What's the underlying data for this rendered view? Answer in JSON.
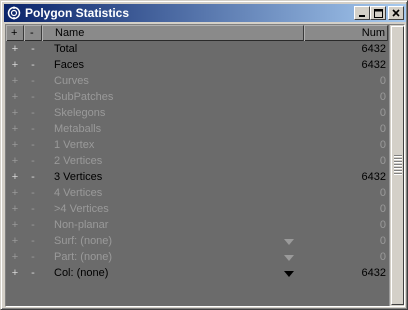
{
  "window": {
    "title": "Polygon Statistics",
    "icon": "lightwave-app-icon"
  },
  "header": {
    "plus_label": "+",
    "minus_label": "-",
    "name_label": "Name",
    "num_label": "Num"
  },
  "rows": [
    {
      "plus": "+",
      "minus": "-",
      "name": "Total",
      "value": "6432",
      "active": true,
      "dropdown": false
    },
    {
      "plus": "+",
      "minus": "-",
      "name": "Faces",
      "value": "6432",
      "active": true,
      "dropdown": false
    },
    {
      "plus": "+",
      "minus": "-",
      "name": "Curves",
      "value": "0",
      "active": false,
      "dropdown": false
    },
    {
      "plus": "+",
      "minus": "-",
      "name": "SubPatches",
      "value": "0",
      "active": false,
      "dropdown": false
    },
    {
      "plus": "+",
      "minus": "-",
      "name": "Skelegons",
      "value": "0",
      "active": false,
      "dropdown": false
    },
    {
      "plus": "+",
      "minus": "-",
      "name": "Metaballs",
      "value": "0",
      "active": false,
      "dropdown": false
    },
    {
      "plus": "+",
      "minus": "-",
      "name": "1 Vertex",
      "value": "0",
      "active": false,
      "dropdown": false
    },
    {
      "plus": "+",
      "minus": "-",
      "name": "2 Vertices",
      "value": "0",
      "active": false,
      "dropdown": false
    },
    {
      "plus": "+",
      "minus": "-",
      "name": "3 Vertices",
      "value": "6432",
      "active": true,
      "dropdown": false
    },
    {
      "plus": "+",
      "minus": "-",
      "name": "4 Vertices",
      "value": "0",
      "active": false,
      "dropdown": false
    },
    {
      "plus": "+",
      "minus": "-",
      "name": ">4 Vertices",
      "value": "0",
      "active": false,
      "dropdown": false
    },
    {
      "plus": "+",
      "minus": "-",
      "name": "Non-planar",
      "value": "0",
      "active": false,
      "dropdown": false
    },
    {
      "plus": "+",
      "minus": "-",
      "name": "Surf: (none)",
      "value": "0",
      "active": false,
      "dropdown": true
    },
    {
      "plus": "+",
      "minus": "-",
      "name": "Part: (none)",
      "value": "0",
      "active": false,
      "dropdown": true
    },
    {
      "plus": "+",
      "minus": "-",
      "name": "Col: (none)",
      "value": "6432",
      "active": true,
      "dropdown": true
    }
  ],
  "colors": {
    "title_gradient_start": "#0a246a",
    "title_gradient_end": "#a6caf0",
    "panel_bg": "#6b6b6b",
    "active_text": "#000000",
    "inactive_text": "#9a9a9a"
  }
}
